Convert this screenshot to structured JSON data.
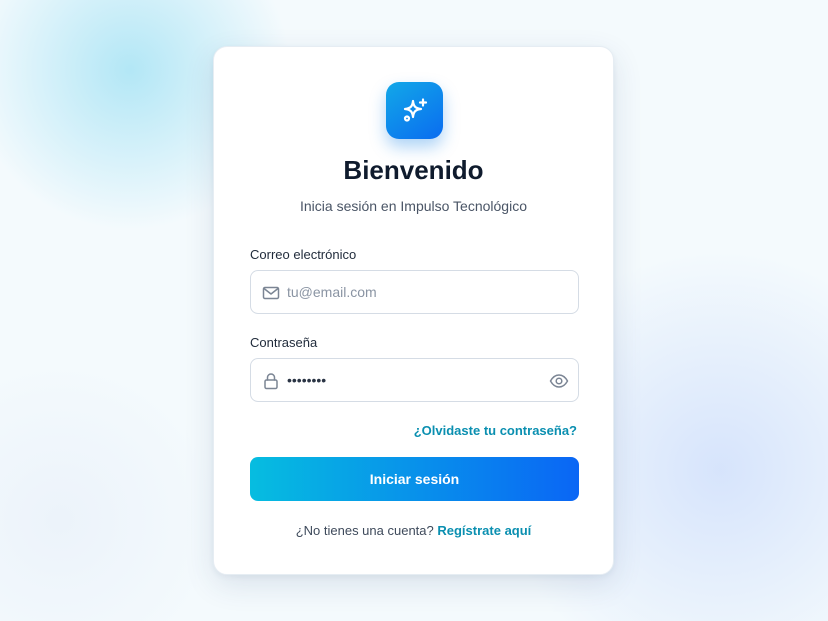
{
  "card": {
    "title": "Bienvenido",
    "subtitle": "Inicia sesión en Impulso Tecnológico",
    "logo_icon": "sparkles-icon"
  },
  "email": {
    "label": "Correo electrónico",
    "placeholder": "tu@email.com",
    "value": "",
    "icon": "mail-icon"
  },
  "password": {
    "label": "Contraseña",
    "value": "••••••••",
    "icon": "lock-icon",
    "toggle_icon": "eye-icon"
  },
  "forgot_link": "¿Olvidaste tu contraseña?",
  "submit_label": "Iniciar sesión",
  "signup": {
    "prompt": "¿No tienes una cuenta?",
    "link": "Regístrate aquí"
  },
  "colors": {
    "accent_link": "#0a8fb0",
    "button_gradient_start": "#06bde0",
    "button_gradient_end": "#0a66f5",
    "logo_gradient_start": "#12a8e8",
    "logo_gradient_end": "#0a6cf0"
  }
}
